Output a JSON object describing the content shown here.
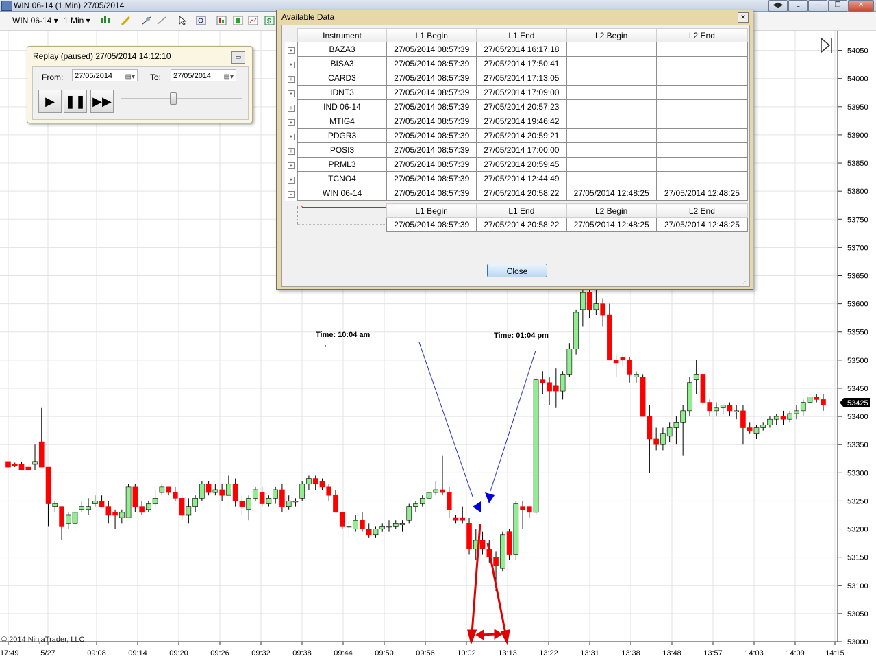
{
  "window": {
    "title": "WIN 06-14 (1 Min)  27/05/2014",
    "controls": [
      "◀▶",
      "L",
      "—",
      "❐",
      "✕"
    ]
  },
  "toolbar": {
    "instrument": "WIN 06-14",
    "interval": "1 Min"
  },
  "replay": {
    "title": "Replay (paused) 27/05/2014 14:12:10",
    "from_label": "From:",
    "from_value": "27/05/2014",
    "to_label": "To:",
    "to_value": "27/05/2014",
    "slider_position": 0.43
  },
  "dialog": {
    "title": "Available Data",
    "headers": [
      "Instrument",
      "L1 Begin",
      "L1 End",
      "L2 Begin",
      "L2 End"
    ],
    "rows": [
      {
        "instrument": "BAZA3",
        "l1_begin": "27/05/2014 08:57:39",
        "l1_end": "27/05/2014 16:17:18",
        "l2_begin": "",
        "l2_end": ""
      },
      {
        "instrument": "BISA3",
        "l1_begin": "27/05/2014 08:57:39",
        "l1_end": "27/05/2014 17:50:41",
        "l2_begin": "",
        "l2_end": ""
      },
      {
        "instrument": "CARD3",
        "l1_begin": "27/05/2014 08:57:39",
        "l1_end": "27/05/2014 17:13:05",
        "l2_begin": "",
        "l2_end": ""
      },
      {
        "instrument": "IDNT3",
        "l1_begin": "27/05/2014 08:57:39",
        "l1_end": "27/05/2014 17:09:00",
        "l2_begin": "",
        "l2_end": ""
      },
      {
        "instrument": "IND 06-14",
        "l1_begin": "27/05/2014 08:57:39",
        "l1_end": "27/05/2014 20:57:23",
        "l2_begin": "",
        "l2_end": ""
      },
      {
        "instrument": "MTIG4",
        "l1_begin": "27/05/2014 08:57:39",
        "l1_end": "27/05/2014 19:46:42",
        "l2_begin": "",
        "l2_end": ""
      },
      {
        "instrument": "PDGR3",
        "l1_begin": "27/05/2014 08:57:39",
        "l1_end": "27/05/2014 20:59:21",
        "l2_begin": "",
        "l2_end": ""
      },
      {
        "instrument": "POSI3",
        "l1_begin": "27/05/2014 08:57:39",
        "l1_end": "27/05/2014 17:00:00",
        "l2_begin": "",
        "l2_end": ""
      },
      {
        "instrument": "PRML3",
        "l1_begin": "27/05/2014 08:57:39",
        "l1_end": "27/05/2014 20:59:45",
        "l2_begin": "",
        "l2_end": ""
      },
      {
        "instrument": "TCNO4",
        "l1_begin": "27/05/2014 08:57:39",
        "l1_end": "27/05/2014 12:44:49",
        "l2_begin": "",
        "l2_end": ""
      },
      {
        "instrument": "WIN 06-14",
        "l1_begin": "27/05/2014 08:57:39",
        "l1_end": "27/05/2014 20:58:22",
        "l2_begin": "27/05/2014 12:48:25",
        "l2_end": "27/05/2014 12:48:25"
      }
    ],
    "detail_headers": [
      "L1 Begin",
      "L1 End",
      "L2 Begin",
      "L2 End"
    ],
    "detail_row": [
      "27/05/2014 08:57:39",
      "27/05/2014 20:58:22",
      "27/05/2014 12:48:25",
      "27/05/2014 12:48:25"
    ],
    "close_label": "Close"
  },
  "annotations": {
    "left_text": "Time: 10:04 am",
    "right_text": "Time: 01:04 pm"
  },
  "copyright": "© 2014 NinjaTrader, LLC",
  "chart_data": {
    "type": "candlestick",
    "current_price": "53425",
    "y_ticks": [
      53000,
      53050,
      53100,
      53150,
      53200,
      53250,
      53300,
      53350,
      53400,
      53450,
      53500,
      53550,
      53600,
      53650,
      53700,
      53750,
      53800,
      53850,
      53900,
      53950,
      54000,
      54050
    ],
    "ylim": [
      53000,
      54050
    ],
    "x_tick_labels": [
      "17:49",
      "5/27",
      "09:08",
      "09:14",
      "09:20",
      "09:26",
      "09:32",
      "09:38",
      "09:44",
      "09:50",
      "09:56",
      "10:02",
      "13:13",
      "13:22",
      "13:31",
      "13:38",
      "13:48",
      "13:57",
      "14:03",
      "14:09",
      "14:15"
    ],
    "colors": {
      "up": "#90ee90",
      "down": "#ff0000",
      "annotation_line": "#0000cc",
      "annotation_arrow": "#e00000"
    },
    "candles": [
      [
        53320,
        53320,
        53310,
        53310
      ],
      [
        53315,
        53318,
        53310,
        53312
      ],
      [
        53315,
        53320,
        53305,
        53305
      ],
      [
        53310,
        53310,
        53305,
        53305
      ],
      [
        53315,
        53350,
        53305,
        53320
      ],
      [
        53355,
        53415,
        53310,
        53310
      ],
      [
        53310,
        53310,
        53205,
        53245
      ],
      [
        53240,
        53250,
        53230,
        53245
      ],
      [
        53240,
        53240,
        53180,
        53205
      ],
      [
        53210,
        53230,
        53200,
        53225
      ],
      [
        53210,
        53240,
        53200,
        53230
      ],
      [
        53235,
        53250,
        53230,
        53240
      ],
      [
        53235,
        53255,
        53225,
        53240
      ],
      [
        53245,
        53260,
        53240,
        53250
      ],
      [
        53250,
        53260,
        53240,
        53240
      ],
      [
        53240,
        53250,
        53210,
        53225
      ],
      [
        53230,
        53235,
        53200,
        53225
      ],
      [
        53220,
        53235,
        53210,
        53230
      ],
      [
        53220,
        53280,
        53220,
        53275
      ],
      [
        53275,
        53280,
        53230,
        53240
      ],
      [
        53240,
        53250,
        53225,
        53230
      ],
      [
        53235,
        53250,
        53230,
        53245
      ],
      [
        53245,
        53270,
        53240,
        53255
      ],
      [
        53265,
        53280,
        53260,
        53275
      ],
      [
        53275,
        53275,
        53260,
        53265
      ],
      [
        53265,
        53275,
        53250,
        53255
      ],
      [
        53255,
        53260,
        53215,
        53225
      ],
      [
        53225,
        53255,
        53210,
        53240
      ],
      [
        53240,
        53260,
        53230,
        53255
      ],
      [
        53255,
        53285,
        53250,
        53280
      ],
      [
        53280,
        53285,
        53260,
        53265
      ],
      [
        53265,
        53280,
        53260,
        53270
      ],
      [
        53270,
        53280,
        53250,
        53260
      ],
      [
        53260,
        53295,
        53260,
        53280
      ],
      [
        53280,
        53290,
        53240,
        53250
      ],
      [
        53250,
        53260,
        53225,
        53240
      ],
      [
        53235,
        53260,
        53215,
        53255
      ],
      [
        53255,
        53275,
        53250,
        53270
      ],
      [
        53265,
        53275,
        53240,
        53245
      ],
      [
        53245,
        53260,
        53240,
        53255
      ],
      [
        53255,
        53275,
        53245,
        53270
      ],
      [
        53270,
        53280,
        53230,
        53240
      ],
      [
        53240,
        53260,
        53235,
        53250
      ],
      [
        53250,
        53255,
        53240,
        53250
      ],
      [
        53255,
        53285,
        53250,
        53280
      ],
      [
        53280,
        53295,
        53270,
        53290
      ],
      [
        53290,
        53295,
        53270,
        53280
      ],
      [
        53285,
        53290,
        53270,
        53275
      ],
      [
        53275,
        53280,
        53250,
        53260
      ],
      [
        53260,
        53270,
        53230,
        53230
      ],
      [
        53230,
        53230,
        53200,
        53205
      ],
      [
        53205,
        53215,
        53185,
        53205
      ],
      [
        53200,
        53225,
        53195,
        53215
      ],
      [
        53215,
        53230,
        53195,
        53200
      ],
      [
        53200,
        53210,
        53185,
        53190
      ],
      [
        53190,
        53205,
        53185,
        53200
      ],
      [
        53200,
        53210,
        53195,
        53205
      ],
      [
        53205,
        53215,
        53195,
        53205
      ],
      [
        53205,
        53215,
        53200,
        53210
      ],
      [
        53210,
        53215,
        53195,
        53210
      ],
      [
        53215,
        53245,
        53210,
        53240
      ],
      [
        53240,
        53250,
        53230,
        53245
      ],
      [
        53245,
        53260,
        53240,
        53255
      ],
      [
        53255,
        53270,
        53250,
        53265
      ],
      [
        53265,
        53285,
        53260,
        53270
      ],
      [
        53270,
        53330,
        53260,
        53265
      ],
      [
        53265,
        53275,
        53220,
        53235
      ],
      [
        53220,
        53225,
        53210,
        53215
      ],
      [
        53220,
        53240,
        53210,
        53215
      ],
      [
        53210,
        53220,
        53155,
        53165
      ],
      [
        53165,
        53200,
        53145,
        53180
      ],
      [
        53180,
        53195,
        53155,
        53165
      ],
      [
        53165,
        53180,
        53140,
        53150
      ],
      [
        53150,
        53160,
        53090,
        53135
      ],
      [
        53130,
        53195,
        53125,
        53190
      ],
      [
        53195,
        53200,
        53145,
        53155
      ],
      [
        53155,
        53250,
        53145,
        53245
      ],
      [
        53240,
        53250,
        53200,
        53235
      ],
      [
        53240,
        53240,
        53220,
        53230
      ],
      [
        53230,
        53470,
        53225,
        53465
      ],
      [
        53465,
        53480,
        53440,
        53460
      ],
      [
        53460,
        53470,
        53420,
        53445
      ],
      [
        53455,
        53485,
        53415,
        53445
      ],
      [
        53445,
        53480,
        53430,
        53475
      ],
      [
        53475,
        53530,
        53470,
        53520
      ],
      [
        53520,
        53590,
        53510,
        53585
      ],
      [
        53590,
        53640,
        53560,
        53620
      ],
      [
        53620,
        53635,
        53575,
        53590
      ],
      [
        53590,
        53630,
        53580,
        53600
      ],
      [
        53600,
        53610,
        53560,
        53580
      ],
      [
        53580,
        53600,
        53500,
        53500
      ],
      [
        53500,
        53510,
        53470,
        53495
      ],
      [
        53505,
        53510,
        53490,
        53500
      ],
      [
        53500,
        53505,
        53460,
        53475
      ],
      [
        53470,
        53480,
        53460,
        53475
      ],
      [
        53470,
        53475,
        53400,
        53400
      ],
      [
        53400,
        53420,
        53300,
        53360
      ],
      [
        53360,
        53380,
        53340,
        53350
      ],
      [
        53350,
        53380,
        53340,
        53370
      ],
      [
        53365,
        53390,
        53355,
        53380
      ],
      [
        53380,
        53400,
        53350,
        53390
      ],
      [
        53390,
        53420,
        53330,
        53410
      ],
      [
        53410,
        53470,
        53400,
        53460
      ],
      [
        53465,
        53500,
        53440,
        53475
      ],
      [
        53475,
        53480,
        53420,
        53425
      ],
      [
        53425,
        53430,
        53400,
        53410
      ],
      [
        53410,
        53425,
        53400,
        53415
      ],
      [
        53415,
        53420,
        53405,
        53420
      ],
      [
        53420,
        53425,
        53400,
        53410
      ],
      [
        53410,
        53420,
        53395,
        53410
      ],
      [
        53410,
        53420,
        53350,
        53380
      ],
      [
        53380,
        53390,
        53370,
        53375
      ],
      [
        53370,
        53385,
        53360,
        53380
      ],
      [
        53380,
        53390,
        53375,
        53385
      ],
      [
        53385,
        53400,
        53380,
        53395
      ],
      [
        53395,
        53405,
        53385,
        53400
      ],
      [
        53400,
        53410,
        53385,
        53395
      ],
      [
        53395,
        53410,
        53390,
        53405
      ],
      [
        53405,
        53420,
        53395,
        53410
      ],
      [
        53410,
        53430,
        53400,
        53425
      ],
      [
        53425,
        53440,
        53420,
        53435
      ],
      [
        53435,
        53440,
        53425,
        53430
      ],
      [
        53430,
        53440,
        53410,
        53420
      ]
    ]
  }
}
